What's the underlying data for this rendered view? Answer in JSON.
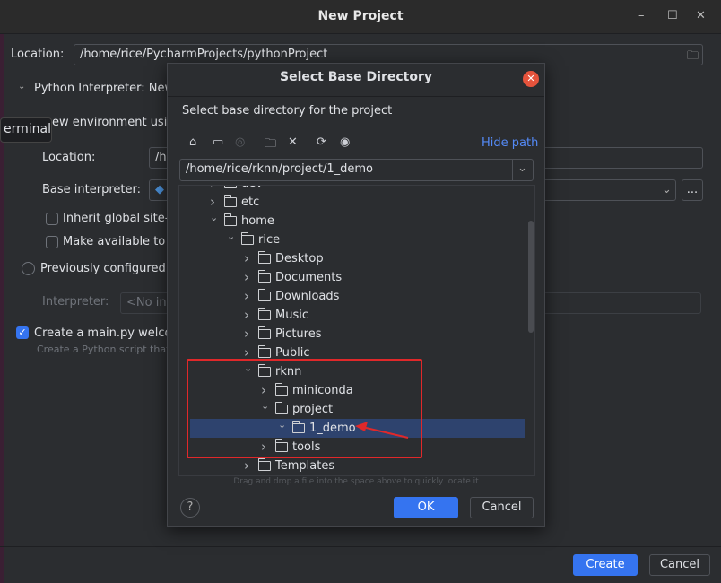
{
  "window": {
    "title": "New Project",
    "minimize": "–",
    "maximize": "☐",
    "close": "✕"
  },
  "main": {
    "location_label": "Location:",
    "location_value": "/home/rice/PycharmProjects/pythonProject",
    "interpreter_section": "Python Interpreter: New",
    "tooltip": "erminal",
    "new_env_label": "ew environment usin",
    "env_location_label": "Location:",
    "env_location_value": "/h",
    "base_interpreter_label": "Base interpreter:",
    "inherit_label": "Inherit global site-",
    "make_available_label": "Make available to a",
    "prev_configured_label": "Previously configured",
    "interpreter_label": "Interpreter:",
    "interpreter_value": "<No in",
    "create_main_label": "Create a main.py welco",
    "create_main_checked": true,
    "create_main_hint": "Create a Python script that",
    "browse_label": "...",
    "create_button": "Create",
    "cancel_button": "Cancel"
  },
  "dialog": {
    "title": "Select Base Directory",
    "subtitle": "Select base directory for the project",
    "hide_path": "Hide path",
    "path_value": "/home/rice/rknn/project/1_demo",
    "toolbar_icons": [
      "home-icon",
      "desktop-icon",
      "target-icon",
      "new-folder-icon",
      "delete-icon",
      "refresh-icon",
      "show-hidden-icon"
    ],
    "tree": [
      {
        "name": "dev",
        "level": 0,
        "expanded": false
      },
      {
        "name": "etc",
        "level": 0,
        "expanded": false
      },
      {
        "name": "home",
        "level": 0,
        "expanded": true
      },
      {
        "name": "rice",
        "level": 1,
        "expanded": true
      },
      {
        "name": "Desktop",
        "level": 2,
        "expanded": false
      },
      {
        "name": "Documents",
        "level": 2,
        "expanded": false
      },
      {
        "name": "Downloads",
        "level": 2,
        "expanded": false
      },
      {
        "name": "Music",
        "level": 2,
        "expanded": false
      },
      {
        "name": "Pictures",
        "level": 2,
        "expanded": false
      },
      {
        "name": "Public",
        "level": 2,
        "expanded": false
      },
      {
        "name": "rknn",
        "level": 2,
        "expanded": true
      },
      {
        "name": "miniconda",
        "level": 3,
        "expanded": false
      },
      {
        "name": "project",
        "level": 3,
        "expanded": true
      },
      {
        "name": "1_demo",
        "level": 4,
        "expanded": true,
        "selected": true
      },
      {
        "name": "tools",
        "level": 3,
        "expanded": false
      },
      {
        "name": "Templates",
        "level": 2,
        "expanded": false
      }
    ],
    "drag_hint": "Drag and drop a file into the space above to quickly locate it",
    "help": "?",
    "ok_button": "OK",
    "cancel_button": "Cancel"
  },
  "colors": {
    "accent": "#3574f0",
    "selection": "#2e436e",
    "annotation": "#e0282a",
    "close": "#e5533c"
  }
}
